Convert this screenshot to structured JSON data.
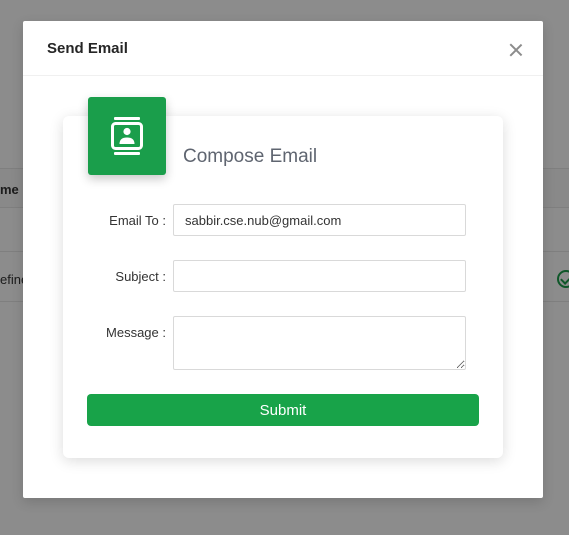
{
  "background": {
    "column_header": "me",
    "cell_text": "efine",
    "check_icon": "check-circle-icon"
  },
  "modal": {
    "title": "Send Email",
    "close_icon": "close-icon"
  },
  "card": {
    "icon": "contact-card-icon",
    "title": "Compose Email"
  },
  "form": {
    "email_to": {
      "label": "Email To :",
      "value": "sabbir.cse.nub@gmail.com"
    },
    "subject": {
      "label": "Subject :",
      "value": ""
    },
    "message": {
      "label": "Message :",
      "value": ""
    },
    "submit_label": "Submit"
  },
  "colors": {
    "accent": "#18a349",
    "title_gray": "#5f6570"
  }
}
